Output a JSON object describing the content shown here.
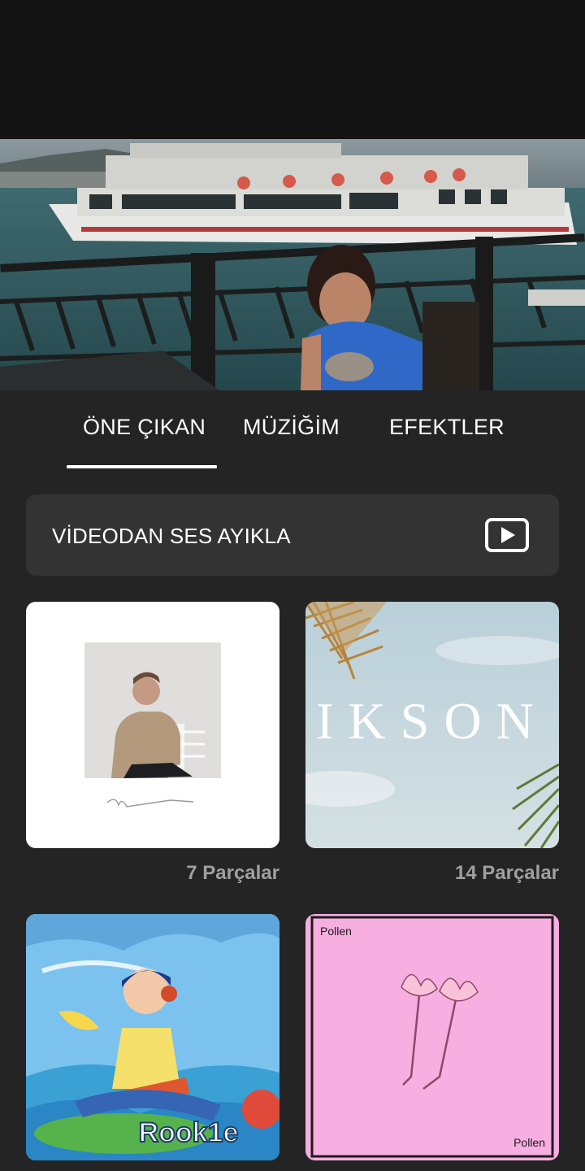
{
  "tabs": [
    {
      "label": "ÖNE ÇIKAN",
      "active": true
    },
    {
      "label": "MÜZİĞİM",
      "active": false
    },
    {
      "label": "EFEKTLER",
      "active": false
    }
  ],
  "extract": {
    "label": "VİDEODAN SES AYIKLA",
    "icon": "video-play-icon"
  },
  "albums": [
    {
      "count": "7 Parçalar",
      "cover_text": ""
    },
    {
      "count": "14 Parçalar",
      "cover_text": "IKSON"
    },
    {
      "count": "",
      "cover_text": "Rook1e"
    },
    {
      "count": "",
      "cover_text_top": "Pollen",
      "cover_text_bottom": "Pollen"
    }
  ],
  "colors": {
    "background": "#242424",
    "tab_active": "#ffffff",
    "count_text": "#a0a0a0",
    "pollen_pink": "#f7aee0"
  }
}
